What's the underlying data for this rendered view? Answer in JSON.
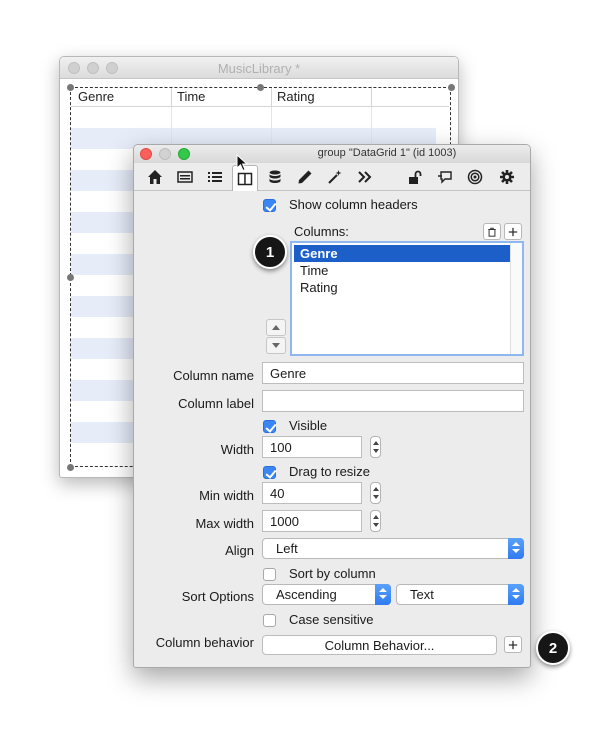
{
  "background_window": {
    "title": "MusicLibrary *",
    "columns": [
      "Genre",
      "Time",
      "Rating"
    ]
  },
  "inspector": {
    "title": "group \"DataGrid 1\" (id 1003)",
    "toolbar_icons": [
      "home-icon",
      "card-icon",
      "list-icon",
      "columns-icon",
      "database-icon",
      "pencil-icon",
      "magic-wand-icon",
      "chevrons-right-icon",
      "unlock-icon",
      "message-icon",
      "target-icon",
      "gear-icon"
    ],
    "show_column_headers": {
      "label": "Show column headers",
      "checked": true
    },
    "columns_label": "Columns:",
    "columns": [
      {
        "name": "Genre",
        "selected": true
      },
      {
        "name": "Time",
        "selected": false
      },
      {
        "name": "Rating",
        "selected": false
      }
    ],
    "column_name": {
      "label": "Column name",
      "value": "Genre"
    },
    "column_label": {
      "label": "Column label",
      "value": ""
    },
    "visible": {
      "label": "Visible",
      "checked": true
    },
    "width": {
      "label": "Width",
      "value": "100"
    },
    "drag_to_resize": {
      "label": "Drag to resize",
      "checked": true
    },
    "min_width": {
      "label": "Min width",
      "value": "40"
    },
    "max_width": {
      "label": "Max width",
      "value": "1000"
    },
    "align": {
      "label": "Align",
      "value": "Left"
    },
    "sort_by_column": {
      "label": "Sort by column",
      "checked": false
    },
    "sort_options": {
      "label": "Sort Options",
      "order": "Ascending",
      "type": "Text"
    },
    "case_sensitive": {
      "label": "Case sensitive",
      "checked": false
    },
    "column_behavior": {
      "label": "Column behavior",
      "button": "Column Behavior..."
    }
  },
  "callouts": [
    "1",
    "2"
  ],
  "colors": {
    "accent": "#3b86f5",
    "selection": "#1d5fc9",
    "stripe": "#e6ecf8"
  }
}
